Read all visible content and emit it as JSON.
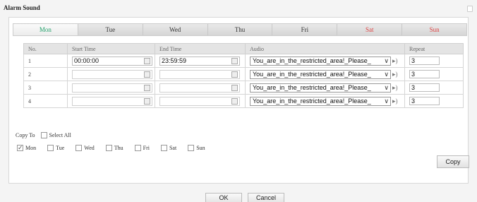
{
  "dialog": {
    "title": "Alarm Sound"
  },
  "tabs": [
    {
      "label": "Mon",
      "active": true,
      "weekend": false
    },
    {
      "label": "Tue",
      "active": false,
      "weekend": false
    },
    {
      "label": "Wed",
      "active": false,
      "weekend": false
    },
    {
      "label": "Thu",
      "active": false,
      "weekend": false
    },
    {
      "label": "Fri",
      "active": false,
      "weekend": false
    },
    {
      "label": "Sat",
      "active": false,
      "weekend": true
    },
    {
      "label": "Sun",
      "active": false,
      "weekend": true
    }
  ],
  "table": {
    "headers": {
      "no": "No.",
      "start": "Start Time",
      "end": "End Time",
      "audio": "Audio",
      "repeat": "Repeat"
    },
    "rows": [
      {
        "no": "1",
        "start": "00:00:00",
        "end": "23:59:59",
        "audio": "You_are_in_the_restricted_area!_Please_",
        "repeat": "3"
      },
      {
        "no": "2",
        "start": "",
        "end": "",
        "audio": "You_are_in_the_restricted_area!_Please_",
        "repeat": "3"
      },
      {
        "no": "3",
        "start": "",
        "end": "",
        "audio": "You_are_in_the_restricted_area!_Please_",
        "repeat": "3"
      },
      {
        "no": "4",
        "start": "",
        "end": "",
        "audio": "You_are_in_the_restricted_area!_Please_",
        "repeat": "3"
      }
    ]
  },
  "copy_to": {
    "label": "Copy To",
    "select_all": "Select All",
    "days": [
      {
        "label": "Mon",
        "checked": true
      },
      {
        "label": "Tue",
        "checked": false
      },
      {
        "label": "Wed",
        "checked": false
      },
      {
        "label": "Thu",
        "checked": false
      },
      {
        "label": "Fri",
        "checked": false
      },
      {
        "label": "Sat",
        "checked": false
      },
      {
        "label": "Sun",
        "checked": false
      }
    ],
    "copy_button": "Copy"
  },
  "footer": {
    "ok": "OK",
    "cancel": "Cancel"
  },
  "colors": {
    "active_tab": "#22a06b",
    "weekend_tab": "#d44444"
  }
}
